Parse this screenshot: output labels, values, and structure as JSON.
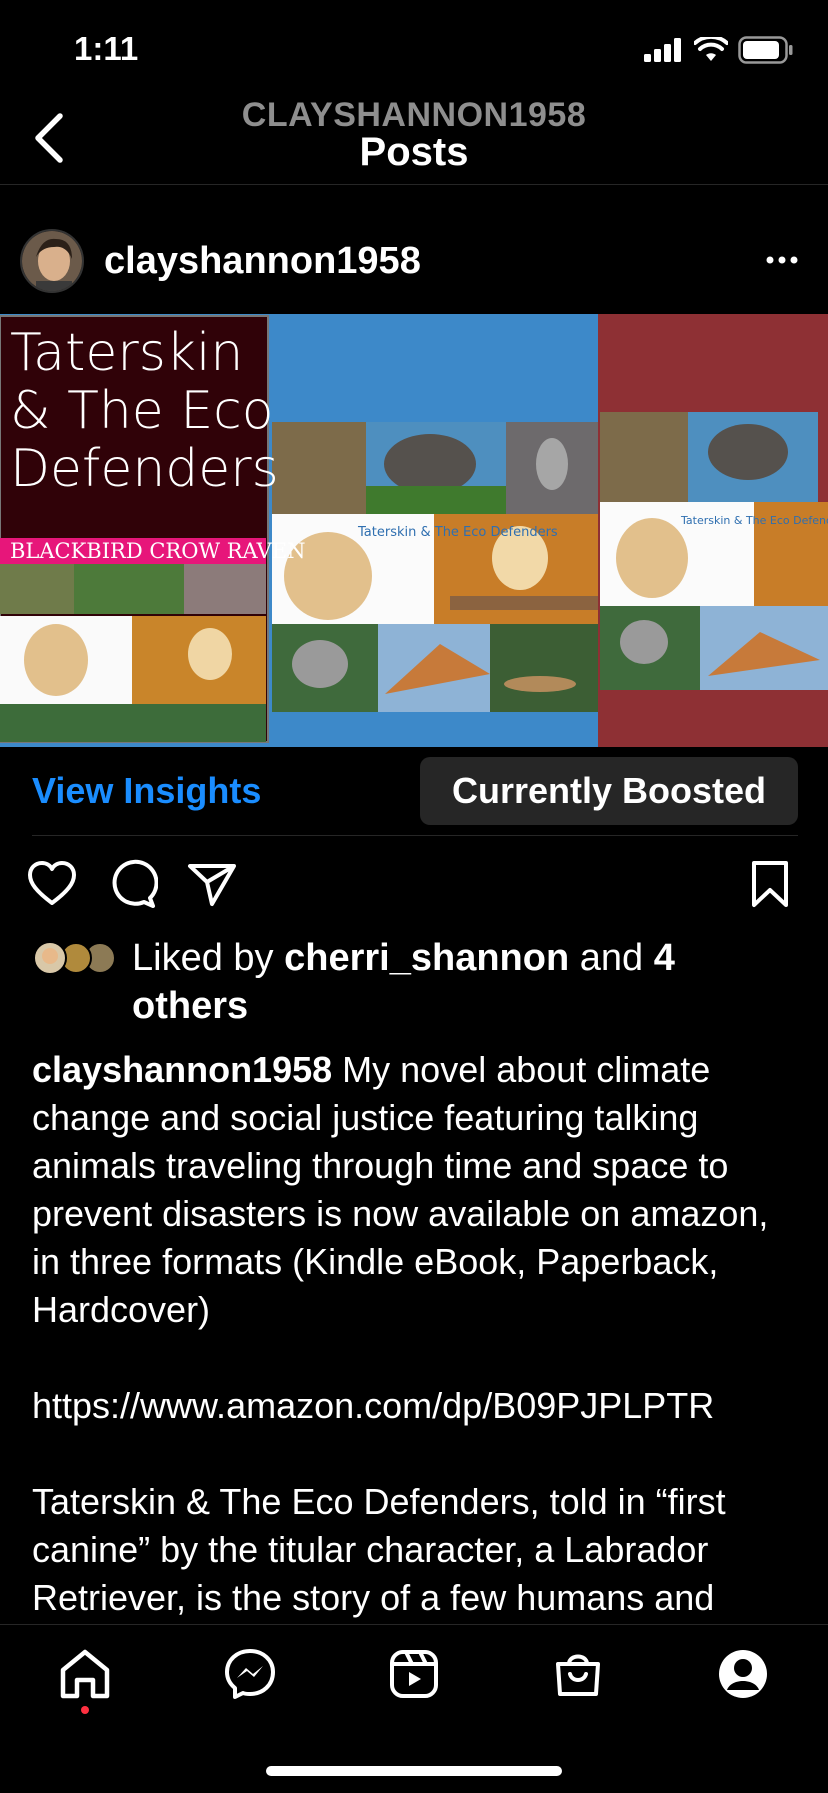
{
  "status": {
    "time": "1:11"
  },
  "header": {
    "subtitle": "CLAYSHANNON1958",
    "title": "Posts"
  },
  "post": {
    "username": "clayshannon1958",
    "image": {
      "book_title": "Taterskin & The Eco Defenders",
      "book_title_lines": [
        "Taterskin",
        "& The Eco",
        "Defenders"
      ],
      "publisher": "BLACKBIRD CROW RAVEN",
      "mini_cover_label": "Taterskin & The Eco Defenders",
      "colors": {
        "dark_cover": "#300208",
        "blue_panel": "#3d89c9",
        "red_panel": "#8e3034",
        "publisher_band": "#e7167a"
      }
    },
    "insights_label": "View Insights",
    "boost_label": "Currently Boosted",
    "likes": {
      "prefix": "Liked by",
      "user": "cherri_shannon",
      "and": "and",
      "count": "4",
      "others": "others"
    },
    "caption": {
      "user": "clayshannon1958",
      "text": " My novel about climate change and social justice featuring talking animals traveling through time and space to prevent disasters is now available on amazon, in three formats (Kindle eBook, Paperback, Hardcover)\n\nhttps://www.amazon.com/dp/B09PJPLPTR\n\nTaterskin & The Eco Defenders, told in “first canine” by the titular character, a Labrador Retriever, is the story of a few humans and"
    }
  },
  "nav": {
    "items": [
      "home-icon",
      "messenger-icon",
      "reels-icon",
      "shop-icon",
      "profile-icon"
    ]
  },
  "colors": {
    "accent": "#1a8dff",
    "notification": "#ff3040"
  }
}
